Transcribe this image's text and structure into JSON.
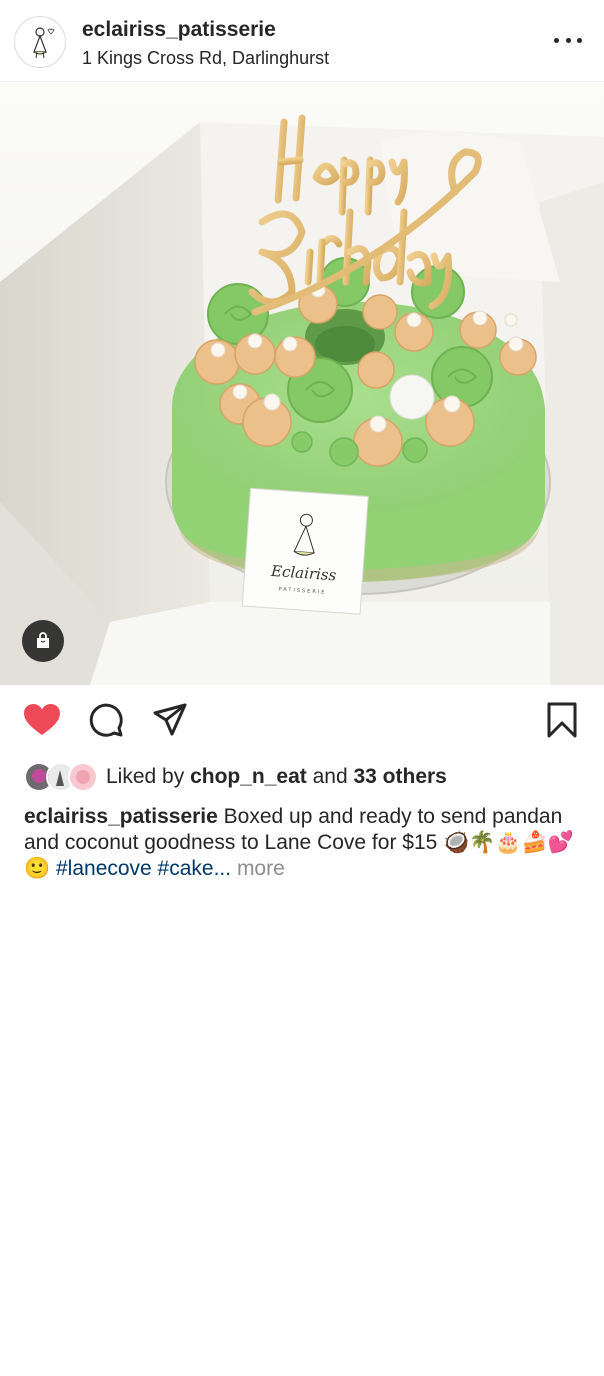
{
  "post": {
    "username": "eclairiss_patisserie",
    "location": "1 Kings Cross Rd, Darlinghurst",
    "topper_text": "Happy Birthday",
    "card_brand": "Eclairiss",
    "card_sub": "PATISSERIE"
  },
  "likes": {
    "prefix": "Liked by ",
    "user": "chop_n_eat",
    "joiner": " and ",
    "others": "33 others"
  },
  "caption": {
    "username": "eclairiss_patisserie",
    "text": " Boxed up and ready to send pandan and coconut goodness to Lane Cove for $15 🥥🌴🎂🍰💕🙂 ",
    "hashtags": "#lanecove #cake...",
    "more": " more"
  },
  "colors": {
    "like_active": "#ed4956",
    "hashtag": "#00376b",
    "muted": "#8e8e8e",
    "cake_green": "#9ed882"
  },
  "icons": {
    "like": "heart-filled",
    "comment": "speech-bubble",
    "share": "paper-plane",
    "save": "bookmark",
    "options": "ellipsis",
    "shopping": "shopping-bag"
  }
}
